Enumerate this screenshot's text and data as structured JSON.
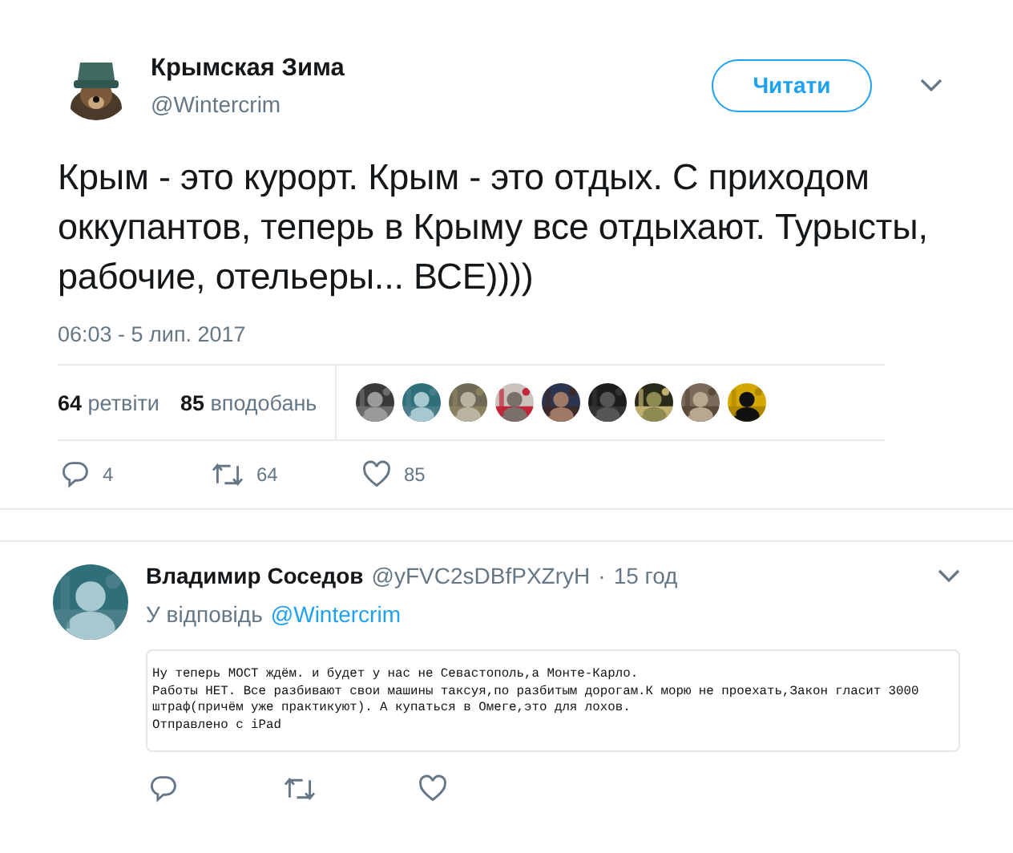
{
  "tweet": {
    "author": {
      "name": "Крымская Зима",
      "handle": "@Wintercrim"
    },
    "follow_button": "Читати",
    "text": "Крым - это курорт. Крым - это отдых. С приходом оккупантов, теперь в Крыму все отдыхают. Турысты, рабочие, отельеры... ВСЕ))))",
    "timestamp": "06:03 - 5 лип. 2017",
    "stats": [
      {
        "count": "64",
        "label": "ретвіти"
      },
      {
        "count": "85",
        "label": "вподобань"
      }
    ],
    "actions": [
      {
        "kind": "reply",
        "count": "4"
      },
      {
        "kind": "retweet",
        "count": "64"
      },
      {
        "kind": "like",
        "count": "85"
      }
    ]
  },
  "reply": {
    "author": {
      "name": "Владимир Соседов",
      "handle": "@yFVC2sDBfPXZryH"
    },
    "separator": "·",
    "time": "15 год",
    "reply_to": {
      "label": "У відповідь",
      "mention": "@Wintercrim"
    },
    "quote_lines": [
      "Ну теперь МОСТ ждём. и будет у нас не Севастополь,а Монте-Карло.",
      "Работы НЕТ. Все разбивают свои машины таксуя,по разбитым дорогам.К морю не проехать,Закон гласит 3000",
      "штраф(причём уже практикуют). А купаться в Омеге,это для лохов.",
      "Отправлено с iPad"
    ],
    "actions": [
      {
        "kind": "reply"
      },
      {
        "kind": "retweet"
      },
      {
        "kind": "like"
      }
    ]
  }
}
